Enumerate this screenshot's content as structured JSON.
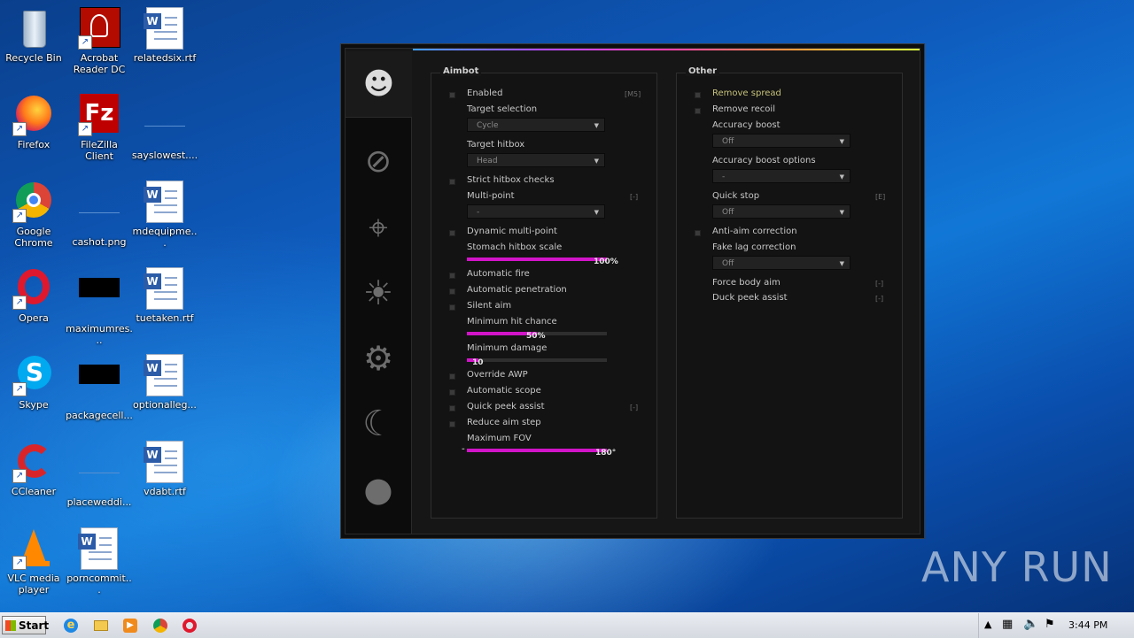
{
  "desktop": {
    "icons": [
      {
        "label": "Recycle Bin"
      },
      {
        "label": "Acrobat Reader DC"
      },
      {
        "label": "relatedsix.rtf"
      },
      {
        "label": "Firefox"
      },
      {
        "label": "FileZilla Client"
      },
      {
        "label": "sayslowest...."
      },
      {
        "label": "Google Chrome"
      },
      {
        "label": "cashot.png"
      },
      {
        "label": "mdequipme..."
      },
      {
        "label": "Opera"
      },
      {
        "label": "maximumres..."
      },
      {
        "label": "tuetaken.rtf"
      },
      {
        "label": "Skype"
      },
      {
        "label": "packagecell..."
      },
      {
        "label": "optionalleg..."
      },
      {
        "label": "CCleaner"
      },
      {
        "label": "placeweddi..."
      },
      {
        "label": "vdabt.rtf"
      },
      {
        "label": "VLC media player"
      },
      {
        "label": "porncommit..."
      }
    ]
  },
  "cheat": {
    "tabs": [
      {
        "icon": "masked-face-icon"
      },
      {
        "icon": "no-target-icon"
      },
      {
        "icon": "crosshair-icon"
      },
      {
        "icon": "brightness-icon"
      },
      {
        "icon": "gears-icon"
      },
      {
        "icon": "knife-icon"
      },
      {
        "icon": "player-icon"
      }
    ],
    "aimbot": {
      "title": "Aimbot",
      "enabled": "Enabled",
      "enabled_key": "[M5]",
      "target_selection": "Target selection",
      "target_selection_value": "Cycle",
      "target_hitbox": "Target hitbox",
      "target_hitbox_value": "Head",
      "strict_hitbox": "Strict hitbox checks",
      "multi_point": "Multi-point",
      "multi_point_key": "[-]",
      "multi_point_value": "-",
      "dynamic_multi_point": "Dynamic multi-point",
      "stomach_scale": "Stomach hitbox scale",
      "stomach_scale_value": "100%",
      "stomach_scale_fraction": 1.0,
      "automatic_fire": "Automatic fire",
      "automatic_penetration": "Automatic penetration",
      "silent_aim": "Silent aim",
      "min_hit_chance": "Minimum hit chance",
      "min_hit_chance_value": "50%",
      "min_hit_chance_fraction": 0.5,
      "min_damage": "Minimum damage",
      "min_damage_value": "10",
      "min_damage_fraction": 0.08,
      "override_awp": "Override AWP",
      "automatic_scope": "Automatic scope",
      "quick_peek": "Quick peek assist",
      "quick_peek_key": "[-]",
      "reduce_aim_step": "Reduce aim step",
      "max_fov": "Maximum FOV",
      "max_fov_minus": "-",
      "max_fov_value": "180°",
      "max_fov_fraction": 1.0
    },
    "other": {
      "title": "Other",
      "remove_spread": "Remove spread",
      "remove_recoil": "Remove recoil",
      "accuracy_boost": "Accuracy boost",
      "accuracy_boost_value": "Off",
      "accuracy_boost_options": "Accuracy boost options",
      "accuracy_boost_options_value": "-",
      "quick_stop": "Quick stop",
      "quick_stop_key": "[E]",
      "quick_stop_value": "Off",
      "anti_aim_correction": "Anti-aim correction",
      "fake_lag_correction": "Fake lag correction",
      "fake_lag_correction_value": "Off",
      "force_body_aim": "Force body aim",
      "force_body_aim_key": "[-]",
      "duck_peek_assist": "Duck peek assist",
      "duck_peek_assist_key": "[-]"
    },
    "accent_color": "#d214c8"
  },
  "taskbar": {
    "start_label": "Start",
    "clock": "3:44 PM"
  },
  "watermark": "ANY RUN"
}
